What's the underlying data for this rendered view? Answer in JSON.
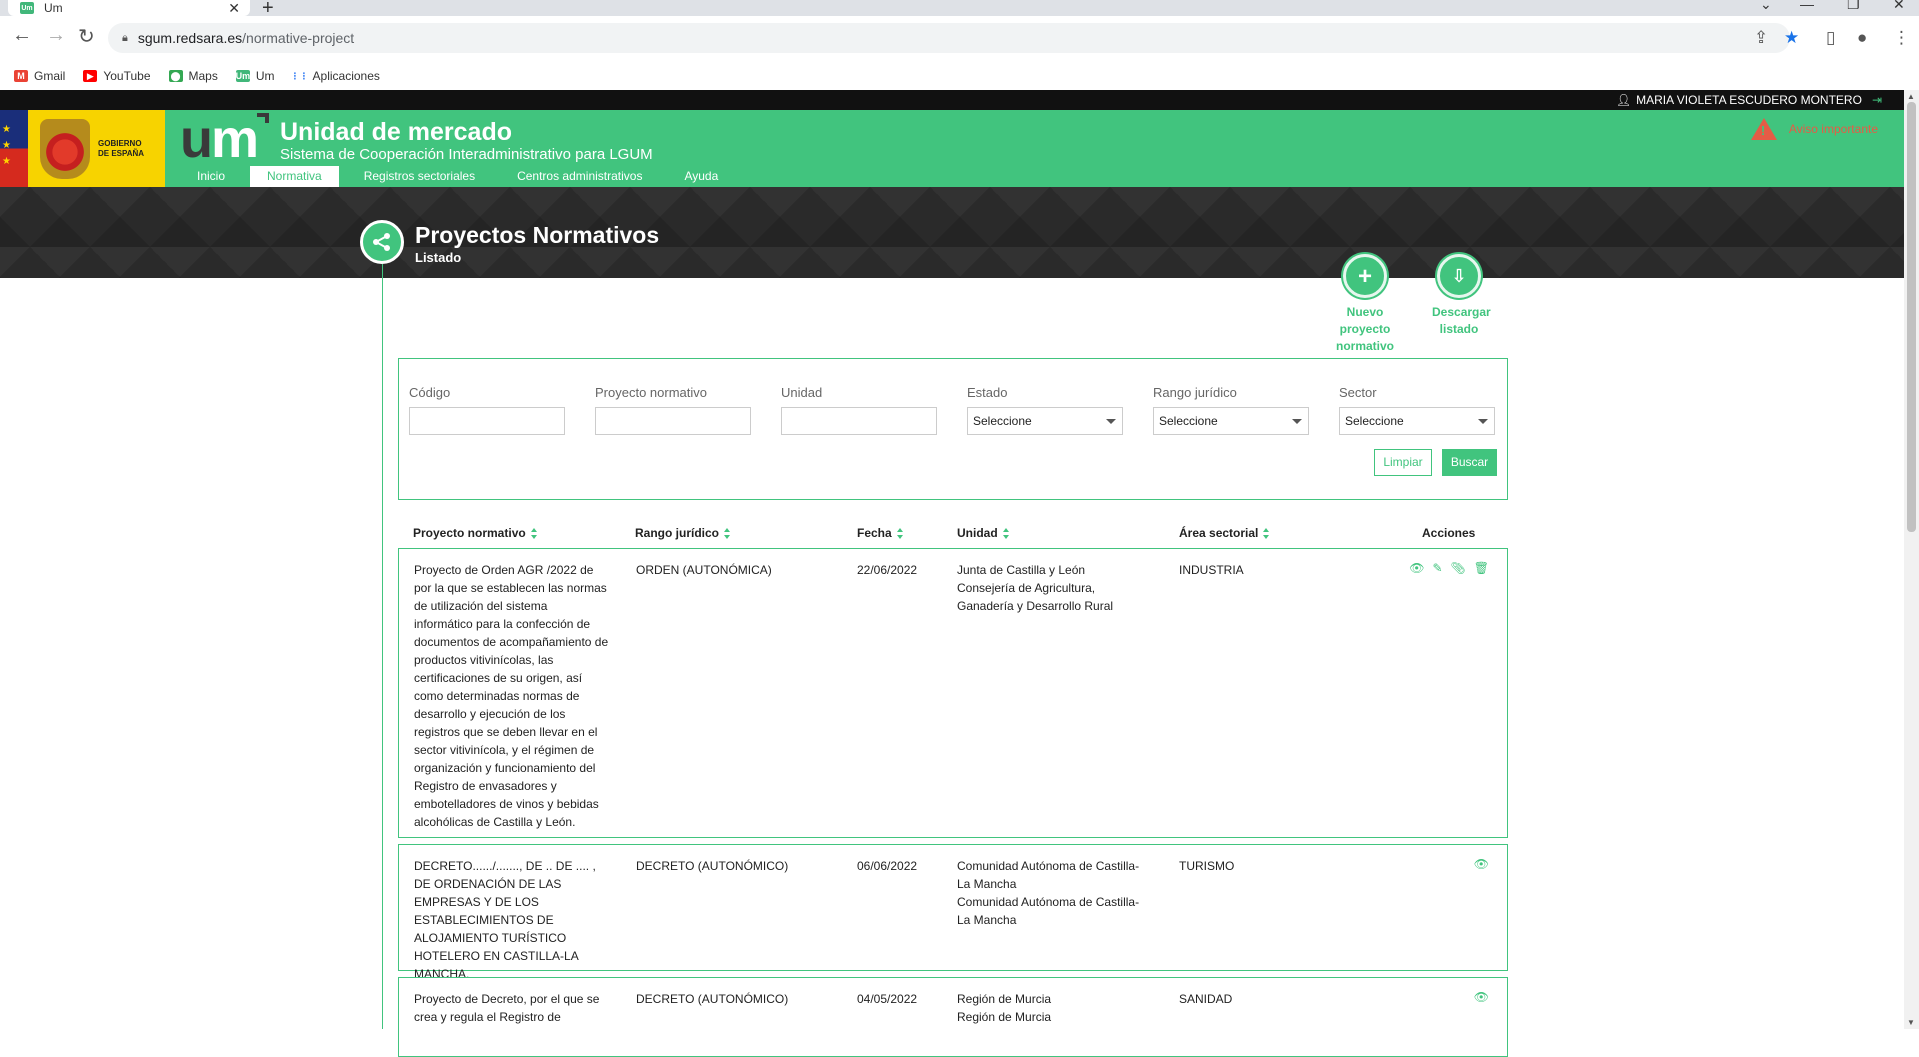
{
  "browser": {
    "tab_title": "Um",
    "tab_favicon": "Um",
    "url_host": "sgum.redsara.es",
    "url_path": "/normative-project",
    "bookmarks": [
      {
        "label": "Gmail",
        "icon": "gmail-icon",
        "color": "#ea4335",
        "glyph": "M"
      },
      {
        "label": "YouTube",
        "icon": "youtube-icon",
        "color": "#ff0000",
        "glyph": "▶"
      },
      {
        "label": "Maps",
        "icon": "maps-icon",
        "color": "#34a853",
        "glyph": "⬤"
      },
      {
        "label": "Um",
        "icon": "um-icon",
        "color": "#41b77a",
        "glyph": "Um"
      },
      {
        "label": "Aplicaciones",
        "icon": "apps-grid-icon",
        "color": "#ffffff",
        "glyph": "⋮⋮"
      }
    ]
  },
  "site": {
    "user_name": "MARIA VIOLETA ESCUDERO MONTERO",
    "gov_text_line1": "GOBIERNO",
    "gov_text_line2": "DE ESPAÑA",
    "logo_u": "u",
    "logo_m": "m",
    "title": "Unidad de mercado",
    "subtitle": "Sistema de Cooperación Interadministrativo para LGUM",
    "alert": "Aviso importante",
    "accent_color": "#41c47e",
    "menu": [
      {
        "label": "Inicio",
        "active": false
      },
      {
        "label": "Normativa",
        "active": true
      },
      {
        "label": "Registros sectoriales",
        "active": false
      },
      {
        "label": "Centros administrativos",
        "active": false
      },
      {
        "label": "Ayuda",
        "active": false
      }
    ]
  },
  "page": {
    "title": "Proyectos Normativos",
    "subtitle": "Listado",
    "actions": {
      "new": "Nuevo proyecto normativo",
      "download": "Descargar listado"
    }
  },
  "filters": {
    "codigo_label": "Código",
    "codigo_value": "",
    "proyecto_label": "Proyecto normativo",
    "proyecto_value": "",
    "unidad_label": "Unidad",
    "unidad_value": "",
    "estado_label": "Estado",
    "estado_value": "Seleccione",
    "rango_label": "Rango jurídico",
    "rango_value": "Seleccione",
    "sector_label": "Sector",
    "sector_value": "Seleccione",
    "clear_label": "Limpiar",
    "search_label": "Buscar"
  },
  "table": {
    "headers": {
      "proyecto": "Proyecto normativo",
      "rango": "Rango jurídico",
      "fecha": "Fecha",
      "unidad": "Unidad",
      "area": "Área sectorial",
      "acciones": "Acciones"
    },
    "rows": [
      {
        "proyecto": "Proyecto de Orden AGR /2022 de por la que se establecen las normas de utilización del sistema informático para la confección de documentos de acompañamiento de productos vitivinícolas, las certificaciones de su origen, así como determinadas normas de desarrollo y ejecución de los registros que se deben llevar en el sector vitivinícola, y el régimen de organización y funcionamiento del Registro de envasadores y embotelladores de vinos y bebidas alcohólicas de Castilla y León.",
        "rango": "ORDEN (AUTONÓMICA)",
        "fecha": "22/06/2022",
        "unidad_1": "Junta de Castilla y León",
        "unidad_2": "Consejería de Agricultura, Ganadería y Desarrollo Rural",
        "area": "INDUSTRIA",
        "actions": [
          "eye-icon",
          "edit-icon",
          "attach-icon",
          "trash-icon"
        ]
      },
      {
        "proyecto": "DECRETO....../......., DE .. DE .... , DE ORDENACIÓN DE LAS EMPRESAS Y DE LOS ESTABLECIMIENTOS DE ALOJAMIENTO TURÍSTICO HOTELERO EN CASTILLA-LA MANCHA.",
        "rango": "DECRETO (AUTONÓMICO)",
        "fecha": "06/06/2022",
        "unidad_1": "Comunidad Autónoma de Castilla-La Mancha",
        "unidad_2": "Comunidad Autónoma de Castilla-La Mancha",
        "area": "TURISMO",
        "actions": [
          "eye-icon"
        ]
      },
      {
        "proyecto": "Proyecto de Decreto, por el que se crea y regula el Registro de",
        "rango": "DECRETO (AUTONÓMICO)",
        "fecha": "04/05/2022",
        "unidad_1": "Región de Murcia",
        "unidad_2": "Región de Murcia",
        "area": "SANIDAD",
        "actions": [
          "eye-icon"
        ]
      }
    ]
  }
}
